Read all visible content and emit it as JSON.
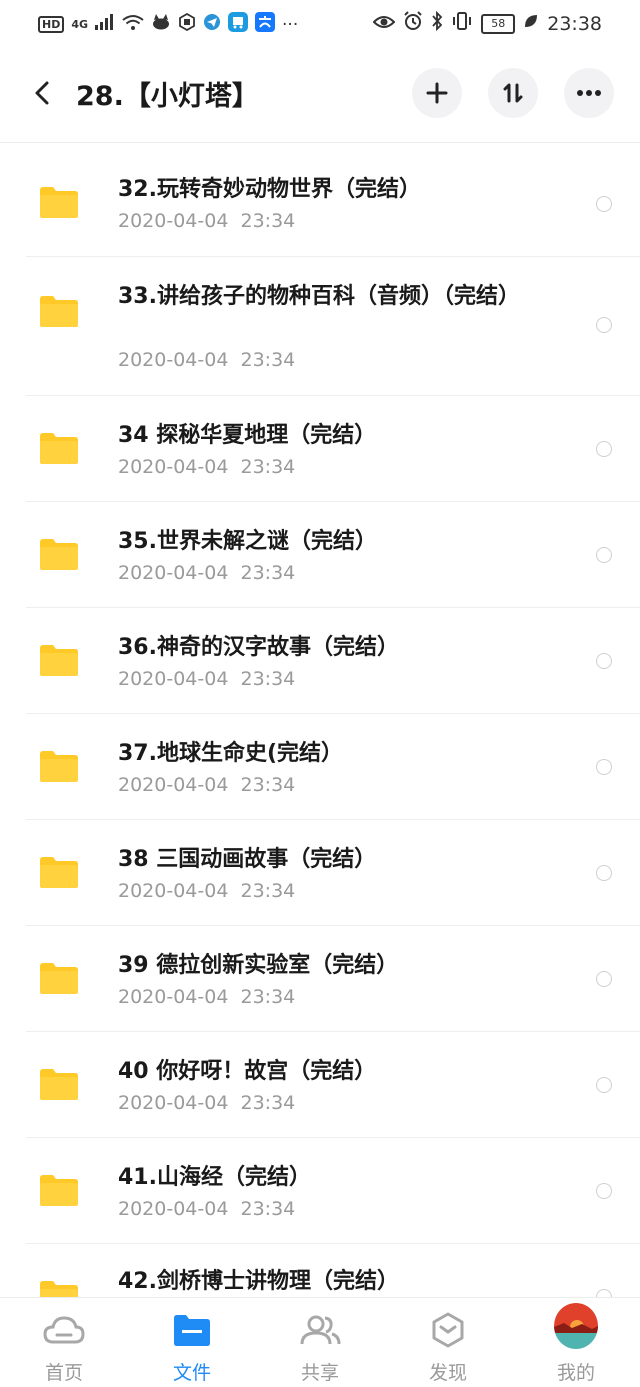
{
  "status_bar": {
    "left_chips": [
      "HD",
      "4G"
    ],
    "signal_icon": "signal-icon",
    "wifi_icon": "wifi-icon",
    "more": "···",
    "battery": "58",
    "time": "23:38"
  },
  "header": {
    "title": "28.【小灯塔】",
    "actions": [
      "add-icon",
      "sort-icon",
      "more-icon"
    ]
  },
  "files": [
    {
      "name": "32.玩转奇妙动物世界（完结）",
      "date": "2020-04-04  23:34"
    },
    {
      "name": "33.讲给孩子的物种百科（音频）（完结）",
      "date": "2020-04-04  23:34"
    },
    {
      "name": "34 探秘华夏地理（完结）",
      "date": "2020-04-04  23:34"
    },
    {
      "name": "35.世界未解之谜（完结）",
      "date": "2020-04-04  23:34"
    },
    {
      "name": "36.神奇的汉字故事（完结）",
      "date": "2020-04-04  23:34"
    },
    {
      "name": "37.地球生命史(完结）",
      "date": "2020-04-04  23:34"
    },
    {
      "name": "38 三国动画故事（完结）",
      "date": "2020-04-04  23:34"
    },
    {
      "name": "39 德拉创新实验室（完结）",
      "date": "2020-04-04  23:34"
    },
    {
      "name": "40 你好呀！故宫（完结）",
      "date": "2020-04-04  23:34"
    },
    {
      "name": "41.山海经（完结）",
      "date": "2020-04-04  23:34"
    },
    {
      "name": "42.剑桥博士讲物理（完结）",
      "date": ""
    }
  ],
  "bottom_nav": [
    {
      "label": "首页",
      "icon": "cloud-icon",
      "active": false
    },
    {
      "label": "文件",
      "icon": "folder-icon",
      "active": true
    },
    {
      "label": "共享",
      "icon": "people-icon",
      "active": false
    },
    {
      "label": "发现",
      "icon": "discover-icon",
      "active": false
    },
    {
      "label": "我的",
      "icon": "avatar",
      "active": false
    }
  ],
  "colors": {
    "accent": "#1f8bf5",
    "folder": "#ffc928",
    "date_text": "#9a9a9a",
    "inactive_tab": "#9a9a9a"
  }
}
